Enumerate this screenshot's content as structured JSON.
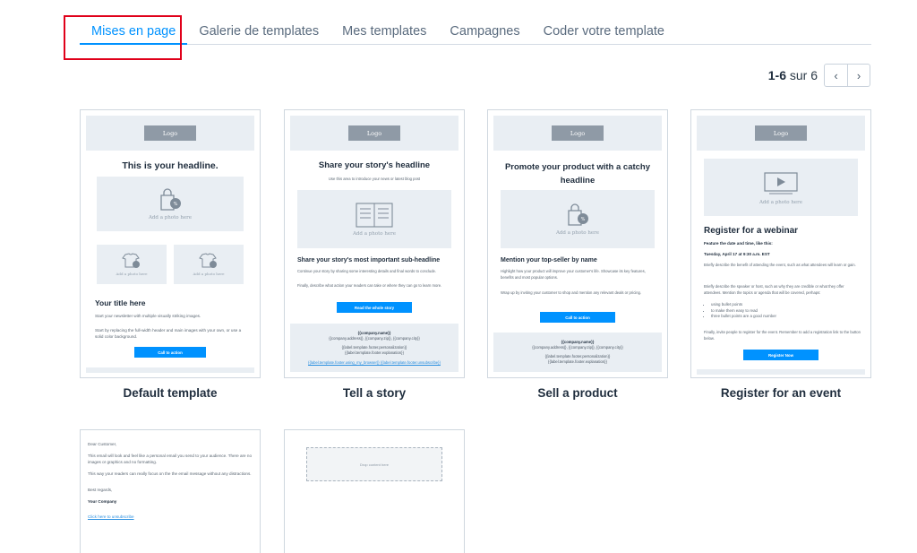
{
  "tabs": [
    {
      "label": "Mises en page",
      "active": true
    },
    {
      "label": "Galerie de templates",
      "active": false
    },
    {
      "label": "Mes templates",
      "active": false
    },
    {
      "label": "Campagnes",
      "active": false
    },
    {
      "label": "Coder votre template",
      "active": false
    }
  ],
  "pagination": {
    "range": "1-6",
    "of_label": "sur 6",
    "prev": "‹",
    "next": "›"
  },
  "colors": {
    "accent": "#0092ff",
    "highlight": "#e0001a",
    "band": "#e9eef3"
  },
  "common": {
    "logo": "Logo",
    "add_photo": "Add a photo here",
    "footer": {
      "company_name": "{{company.name}}",
      "company_address": "{{company.address}}, {{company.zip}}, {{company.city}}",
      "pers": "{{label.template.footer.personalization}}",
      "expl": "{{label.template.footer.explanation}}"
    }
  },
  "templates": [
    {
      "title": "Default template",
      "headline": "This is your headline.",
      "subtitle": "Your title here",
      "p1": "Start your newsletter with multiple visually striking images.",
      "p2": "Start by replacing the full-width header and main images with your own, or use a solid color background.",
      "cta": "Call to action"
    },
    {
      "title": "Tell a story",
      "headline": "Share your story's headline",
      "intro": "Use this area to introduce your news or latest blog post",
      "subtitle": "Share your story's most important sub-headline",
      "p1": "Continue your story by sharing some interesting details and final words to conclude.",
      "p2": "Finally, describe what action your readers can take or where they can go to learn more.",
      "cta": "Read the whole story",
      "footer_links": "{{label.template.footer.using_my_browser}}   {{label.template.footer.unsubscribe}}"
    },
    {
      "title": "Sell a product",
      "headline": "Promote your product with a catchy headline",
      "subtitle": "Mention your top-seller by name",
      "p1": "Highlight how your product will improve your customer's life. Showcase its key features, benefits and most popular options.",
      "p2": "Wrap up by inviting your customer to shop and mention any relevant deals or pricing.",
      "cta": "Call to action"
    },
    {
      "title": "Register for an event",
      "headline": "Register for a webinar",
      "feature": "Feature the date and time, like this:",
      "date": "Tuesday, April 17 at 9:30 a.m. EST",
      "p1": "Briefly describe the benefit of attending the event, such as what attendees will learn or gain.",
      "p2": "Briefly describe the speaker or host, such as why they are credible or what they offer attendees. Mention the topics or agenda that will be covered, perhaps:",
      "bullets": [
        "using bullet points",
        "to make them easy to read",
        "three bullet points are a good number"
      ],
      "p3": "Finally, invite people to register for the event. Remember to add a registration link to the button below.",
      "cta": "Register Now"
    },
    {
      "greeting": "Dear Customer,",
      "p1": "This email will look and feel like a personal email you send to your audience. There are no images or graphics and no formatting.",
      "p2": "This way your readers can really focus on the the email message without any distractions.",
      "regards": "Best regards,",
      "company": "Your Company",
      "unsubscribe": "Click here to unsubscribe"
    },
    {
      "drop": "Drop content here"
    }
  ]
}
